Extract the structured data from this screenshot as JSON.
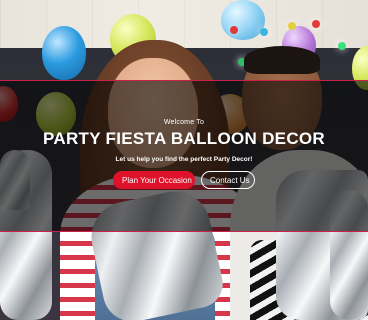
{
  "hero": {
    "eyebrow": "Welcome To",
    "title": "PARTY FIESTA BALLOON DECOR",
    "subtitle": "Let us help you find the perfect Party Decor!",
    "primary_button": "Plan Your Occasion",
    "secondary_button": "Contact Us"
  },
  "colors": {
    "accent": "#e0122b",
    "overlay_border": "#c8224a"
  },
  "background": {
    "image_subject": "party-people-with-balloons"
  }
}
